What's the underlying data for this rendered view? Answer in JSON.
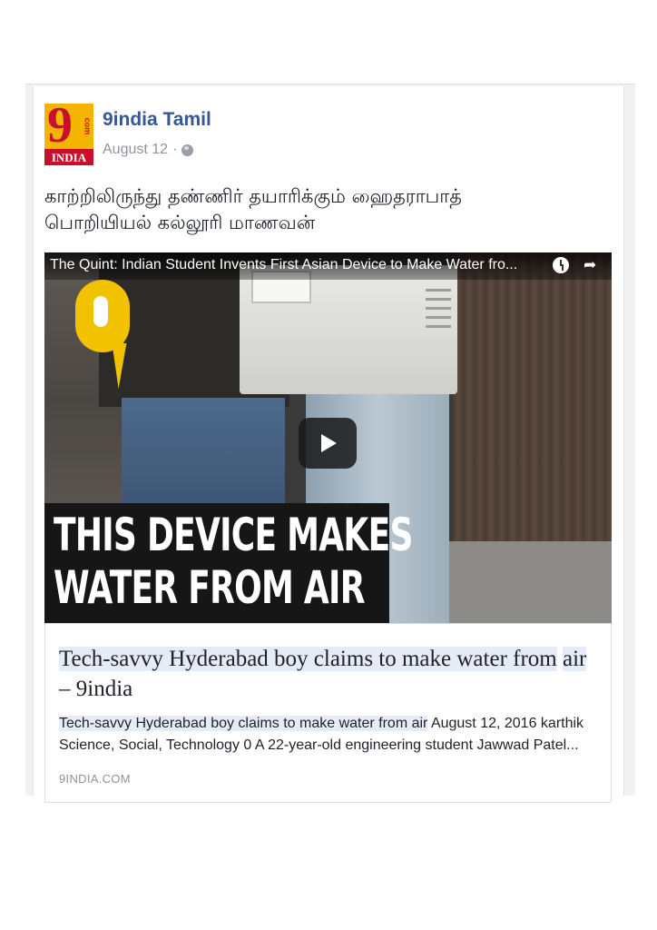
{
  "post": {
    "page_name": "9india Tamil",
    "date": "August 12",
    "date_sep": "·",
    "privacy_icon": "globe-icon",
    "text_line1": "காற்றிலிருந்து தண்ணிர் தயாரிக்கும் ஹைதராபாத்",
    "text_line2": "பொறியியல் கல்லூரி மாணவன்"
  },
  "logo": {
    "nine": "9",
    "com": "com",
    "india": "INDIA"
  },
  "video": {
    "title": "The Quint: Indian Student Invents First Asian Device to Make Water fro...",
    "caption_line1": "THIS DEVICE MAKES",
    "caption_line2": "WATER FROM AIR",
    "watch_later_icon": "clock-icon",
    "share_icon": "share-arrow-icon",
    "share_glyph": "➦"
  },
  "link": {
    "title_part1": "Tech-savvy Hyderabad boy claims to make water from",
    "title_part2": "air",
    "title_part3": " – 9india",
    "desc_highlight": "Tech-savvy Hyderabad boy claims to make water from air",
    "desc_rest": " August 12, 2016 karthik Science, Social, Technology 0 A 22-year-old engineering student Jawwad Patel...",
    "domain": "9INDIA.COM"
  },
  "colors": {
    "page_name": "#365899",
    "meta": "#90949c",
    "logo_bg": "#f4b400",
    "logo_red": "#c8102e",
    "quint_yellow": "#f2c200"
  }
}
